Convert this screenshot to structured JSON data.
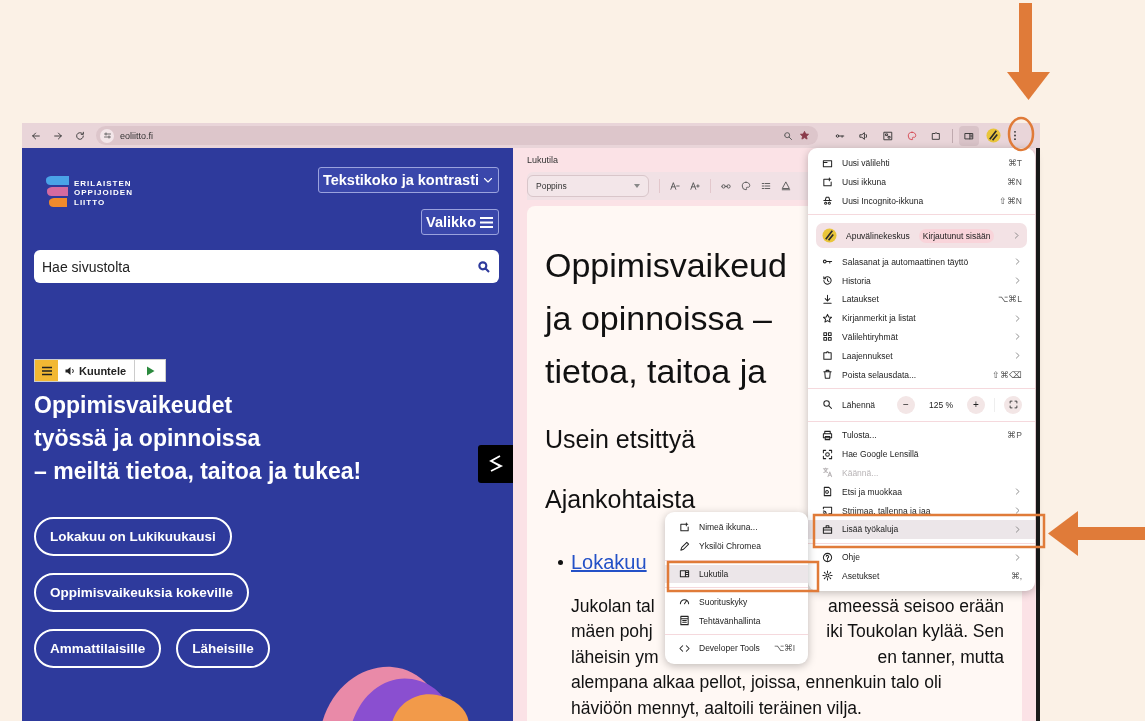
{
  "toolbar": {
    "url": "eoliitto.fi",
    "bookmarked": true
  },
  "site": {
    "logo_lines": [
      "ERILAISTEN",
      "OPPIJOIDEN",
      "LIITTO"
    ],
    "text_size_button": "Tekstikoko ja kontrasti",
    "menu_button": "Valikko",
    "search": {
      "placeholder": "Hae sivustolta"
    },
    "listen_button": "Kuuntele",
    "headline_lines": [
      "Oppimisvaikeudet",
      "työssä ja opinnoissa",
      "– meiltä tietoa, taitoa ja tukea!"
    ],
    "links": [
      [
        "Lokakuu on Lukikuukausi"
      ],
      [
        "Oppimisvaikeuksia kokeville"
      ],
      [
        "Ammattilaisille",
        "Läheisille"
      ]
    ]
  },
  "reading_mode": {
    "title": "Lukutila",
    "font": "Poppins",
    "heading_lines": [
      "Oppimisvaikeud",
      "ja opinnoissa –",
      "tietoa, taitoa ja"
    ],
    "sections": [
      "Usein etsittyä",
      "Ajankohtaista"
    ],
    "link": "Lokakuu",
    "paragraph_lines": [
      [
        "Jukolan tal",
        "ameessä seisoo erään"
      ],
      [
        "mäen pohj",
        "iki Toukolan kylää. Sen"
      ],
      [
        "läheisin ym",
        "en tanner, mutta"
      ],
      [
        "alempana alkaa pellot, joissa, ennenkuin talo oli"
      ],
      [
        "häviöön mennyt, aaltoili teräinen vilja."
      ]
    ]
  },
  "menu": {
    "items": [
      {
        "kind": "item",
        "label": "Uusi välilehti",
        "shortcut": "⌘T",
        "submenu": false,
        "disabled": false,
        "highlighted": false
      },
      {
        "kind": "item",
        "label": "Uusi ikkuna",
        "shortcut": "⌘N",
        "submenu": false,
        "disabled": false,
        "highlighted": false
      },
      {
        "kind": "item",
        "label": "Uusi Incognito-ikkuna",
        "shortcut": "⇧⌘N",
        "submenu": false,
        "disabled": false,
        "highlighted": false
      },
      {
        "kind": "divider"
      },
      {
        "kind": "profile",
        "label": "Apuvälinekeskus",
        "badge": "Kirjautunut sisään",
        "submenu": true
      },
      {
        "kind": "item",
        "label": "Salasanat ja automaattinen täyttö",
        "submenu": true,
        "disabled": false,
        "highlighted": false
      },
      {
        "kind": "item",
        "label": "Historia",
        "submenu": true,
        "disabled": false,
        "highlighted": false
      },
      {
        "kind": "item",
        "label": "Lataukset",
        "shortcut": "⌥⌘L",
        "submenu": false,
        "disabled": false,
        "highlighted": false
      },
      {
        "kind": "item",
        "label": "Kirjanmerkit ja listat",
        "submenu": true,
        "disabled": false,
        "highlighted": false
      },
      {
        "kind": "item",
        "label": "Välilehtiryhmät",
        "submenu": true,
        "disabled": false,
        "highlighted": false
      },
      {
        "kind": "item",
        "label": "Laajennukset",
        "submenu": true,
        "disabled": false,
        "highlighted": false
      },
      {
        "kind": "item",
        "label": "Poista selausdata...",
        "shortcut": "⇧⌘⌫",
        "submenu": false,
        "disabled": false,
        "highlighted": false
      },
      {
        "kind": "divider"
      },
      {
        "kind": "zoom",
        "label": "Lähennä",
        "minus": "−",
        "value": "125 %",
        "plus": "+"
      },
      {
        "kind": "divider"
      },
      {
        "kind": "item",
        "label": "Tulosta...",
        "shortcut": "⌘P",
        "submenu": false,
        "disabled": false,
        "highlighted": false
      },
      {
        "kind": "item",
        "label": "Hae Google Lensillä",
        "submenu": false,
        "disabled": false,
        "highlighted": false
      },
      {
        "kind": "item",
        "label": "Käännä...",
        "submenu": false,
        "disabled": true,
        "highlighted": false
      },
      {
        "kind": "item",
        "label": "Etsi ja muokkaa",
        "submenu": true,
        "disabled": false,
        "highlighted": false
      },
      {
        "kind": "item",
        "label": "Striimaa, tallenna ja jaa",
        "submenu": true,
        "disabled": false,
        "highlighted": false
      },
      {
        "kind": "item",
        "label": "Lisää työkaluja",
        "submenu": true,
        "disabled": false,
        "highlighted": true
      },
      {
        "kind": "divider"
      },
      {
        "kind": "item",
        "label": "Ohje",
        "submenu": true,
        "disabled": false,
        "highlighted": false
      },
      {
        "kind": "item",
        "label": "Asetukset",
        "shortcut": "⌘,",
        "submenu": false,
        "disabled": false,
        "highlighted": false
      }
    ]
  },
  "submenu": {
    "items": [
      {
        "kind": "item",
        "label": "Nimeä ikkuna...",
        "submenu": false,
        "disabled": false,
        "highlighted": false
      },
      {
        "kind": "item",
        "label": "Yksilöi Chromea",
        "submenu": false,
        "disabled": false,
        "highlighted": false
      },
      {
        "kind": "divider"
      },
      {
        "kind": "item",
        "label": "Lukutila",
        "submenu": false,
        "disabled": false,
        "highlighted": true
      },
      {
        "kind": "divider"
      },
      {
        "kind": "item",
        "label": "Suorituskyky",
        "submenu": false,
        "disabled": false,
        "highlighted": false
      },
      {
        "kind": "item",
        "label": "Tehtävänhallinta",
        "submenu": false,
        "disabled": false,
        "highlighted": false
      },
      {
        "kind": "divider"
      },
      {
        "kind": "item",
        "label": "Developer Tools",
        "shortcut": "⌥⌘I",
        "submenu": false,
        "disabled": false,
        "highlighted": false
      }
    ]
  }
}
